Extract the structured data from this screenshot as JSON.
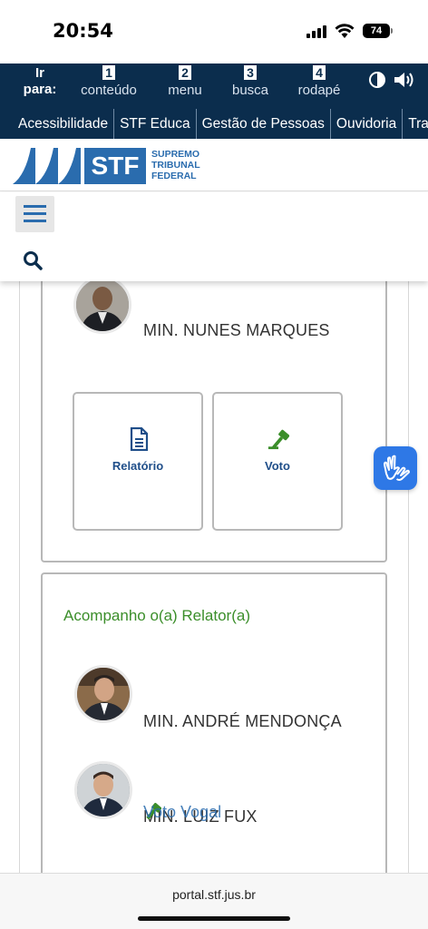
{
  "status": {
    "time": "20:54",
    "battery": "74"
  },
  "topnav": {
    "goto_label_1": "Ir",
    "goto_label_2": "para:",
    "skip_links": [
      {
        "num": "1",
        "label": "conteúdo"
      },
      {
        "num": "2",
        "label": "menu"
      },
      {
        "num": "3",
        "label": "busca"
      },
      {
        "num": "4",
        "label": "rodapé"
      }
    ],
    "icons": [
      "contrast-icon",
      "audio-icon"
    ]
  },
  "linkbar": {
    "items": [
      "Acessibilidade",
      "STF Educa",
      "Gestão de Pessoas",
      "Ouvidoria",
      "Trans"
    ]
  },
  "logo": {
    "abbr": "STF",
    "line1": "SUPREMO",
    "line2": "TRIBUNAL",
    "line3": "FEDERAL",
    "brand_color": "#2a6cae"
  },
  "card1": {
    "minister": "MIN. NUNES MARQUES",
    "actions": [
      {
        "label": "Relatório",
        "icon": "document-icon"
      },
      {
        "label": "Voto",
        "icon": "gavel-icon"
      }
    ]
  },
  "card2": {
    "heading": "Acompanho o(a) Relator(a)",
    "heading_color": "#3b8e2a",
    "ministers": [
      "MIN. ANDRÉ MENDONÇA",
      "MIN. LUIZ FUX"
    ],
    "overlay_label": "Voto Vogal"
  },
  "footer": {
    "url": "portal.stf.jus.br"
  }
}
